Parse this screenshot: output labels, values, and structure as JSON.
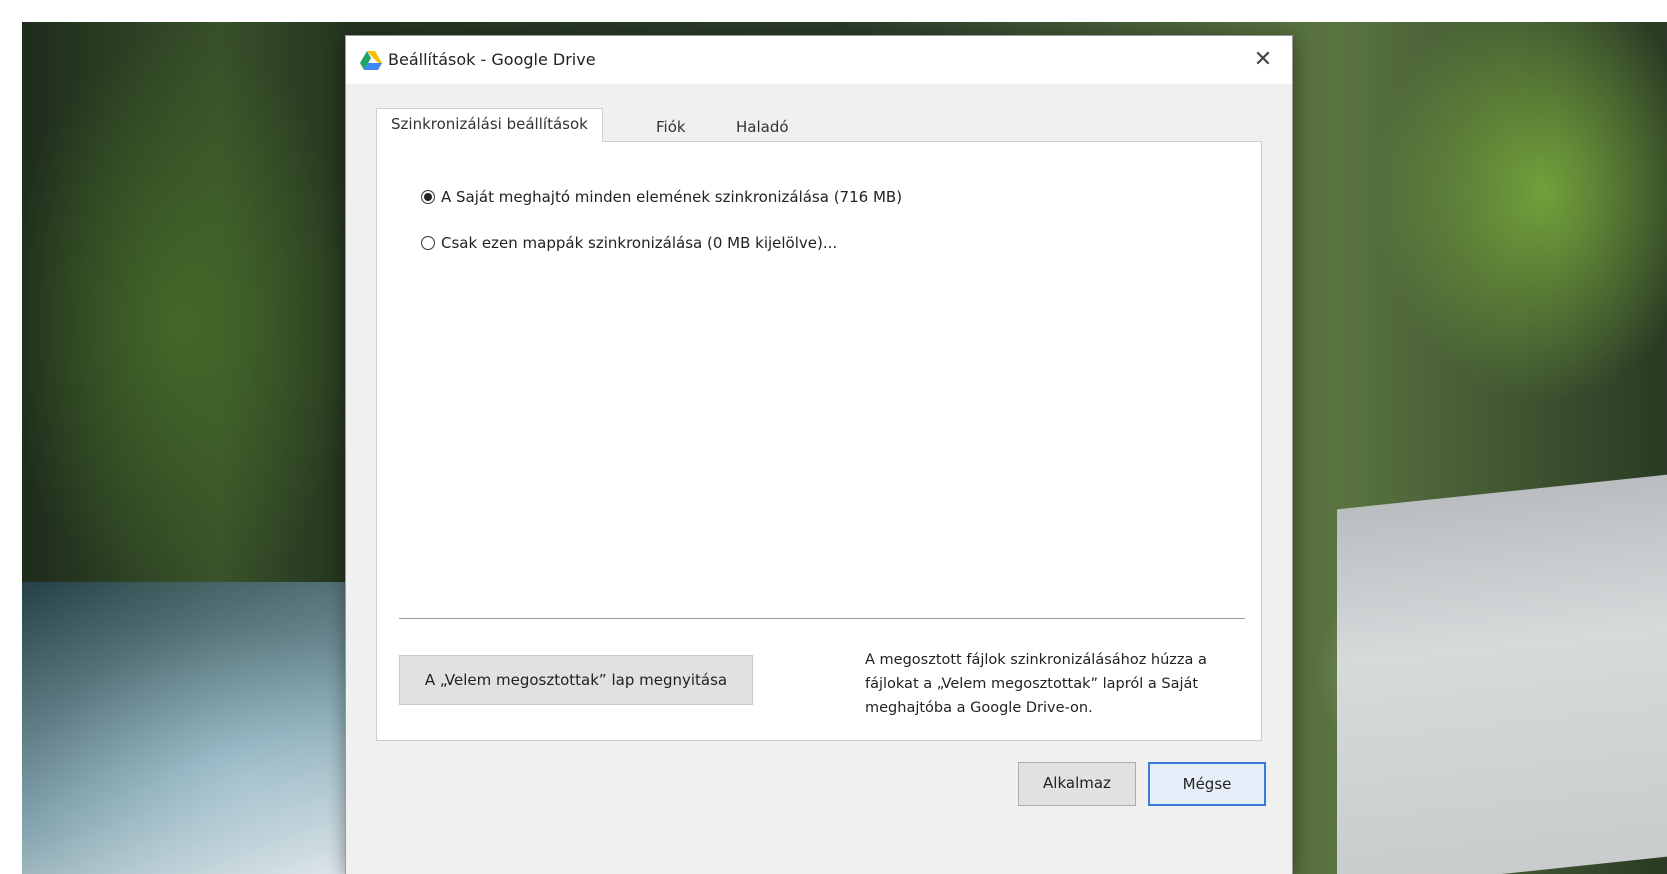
{
  "window": {
    "title": "Beállítások - Google Drive",
    "close_icon": "close-icon",
    "app_icon": "google-drive-icon"
  },
  "tabs": [
    {
      "label": "Szinkronizálási beállítások",
      "active": true
    },
    {
      "label": "Fiók",
      "active": false
    },
    {
      "label": "Haladó",
      "active": false
    }
  ],
  "sync_options": [
    {
      "label": "A Saját meghajtó minden elemének szinkronizálása (716 MB)",
      "selected": true
    },
    {
      "label": "Csak ezen mappák szinkronizálása (0 MB kijelölve)...",
      "selected": false
    }
  ],
  "shared": {
    "button_label": "A „Velem megosztottak” lap megnyitása",
    "hint": "A megosztott fájlok szinkronizálásához húzza a fájlokat a „Velem megosztottak” lapról a Saját meghajtóba a Google Drive-on."
  },
  "footer": {
    "apply_label": "Alkalmaz",
    "cancel_label": "Mégse"
  },
  "colors": {
    "accent": "#3a7bd5",
    "dialog_bg": "#f0f0f0"
  }
}
